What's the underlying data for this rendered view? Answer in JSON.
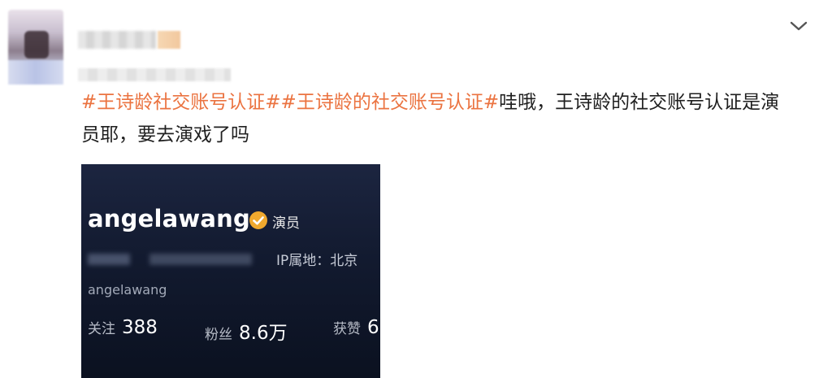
{
  "post": {
    "hashtags": [
      "#王诗龄社交账号认证#",
      "#王诗龄的社交账号认证#"
    ],
    "body_text": "哇哦，王诗龄的社交账号认证是演员耶，要去演戏了吗"
  },
  "profile_card": {
    "username": "angelawang",
    "verify_label": "演员",
    "ip_location": "IP属地：北京",
    "handle": "angelawang",
    "stats": [
      {
        "label": "关注",
        "value": "388"
      },
      {
        "label": "粉丝",
        "value": "8.6万"
      },
      {
        "label": "获赞",
        "value": "6"
      }
    ]
  },
  "icons": {
    "menu": "chevron-down-icon",
    "verify": "verified-badge-icon"
  },
  "colors": {
    "hashtag": "#eb7340",
    "verify_badge": "#f0a92e",
    "card_background": "#121a2f"
  }
}
